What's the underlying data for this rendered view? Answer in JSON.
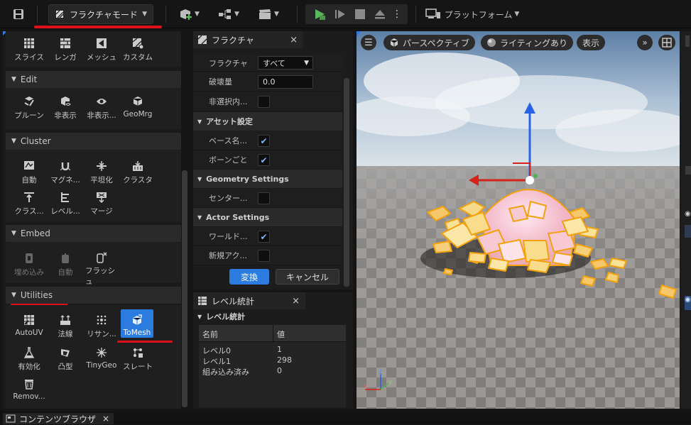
{
  "toolbar": {
    "mode_label": "フラクチャモード",
    "platform_label": "プラットフォーム"
  },
  "colors": {
    "accent": "#2b7be0",
    "annotation": "#e0101a",
    "play": "#5cb85c"
  },
  "tools_top": [
    {
      "label": "スライス",
      "icon": "slice-icon"
    },
    {
      "label": "レンガ",
      "icon": "brick-icon"
    },
    {
      "label": "メッシュ",
      "icon": "mesh-icon"
    },
    {
      "label": "カスタム",
      "icon": "custom-icon"
    }
  ],
  "sections": {
    "edit": {
      "title": "Edit",
      "tools": [
        {
          "label": "プルーン",
          "icon": "prune-icon"
        },
        {
          "label": "非表示",
          "icon": "hide-icon"
        },
        {
          "label": "非表示...",
          "icon": "unhide-icon"
        },
        {
          "label": "GeoMrg",
          "icon": "geomerge-icon"
        }
      ]
    },
    "cluster": {
      "title": "Cluster",
      "tools": [
        {
          "label": "自動",
          "icon": "auto-cluster-icon"
        },
        {
          "label": "マグネ...",
          "icon": "magnet-icon"
        },
        {
          "label": "平坦化",
          "icon": "flatten-icon"
        },
        {
          "label": "クラスタ",
          "icon": "cluster-icon"
        },
        {
          "label": "クラス...",
          "icon": "cluster-up-icon"
        },
        {
          "label": "レベル...",
          "icon": "level-icon"
        },
        {
          "label": "マージ",
          "icon": "merge-icon"
        }
      ]
    },
    "embed": {
      "title": "Embed",
      "tools": [
        {
          "label": "埋め込み",
          "icon": "embed-icon"
        },
        {
          "label": "自動",
          "icon": "auto-embed-icon"
        },
        {
          "label": "フラッシュ",
          "icon": "flush-icon"
        }
      ]
    },
    "utilities": {
      "title": "Utilities",
      "tools": [
        {
          "label": "AutoUV",
          "icon": "autouv-icon"
        },
        {
          "label": "法線",
          "icon": "normals-icon"
        },
        {
          "label": "リサン...",
          "icon": "resample-icon"
        },
        {
          "label": "ToMesh",
          "icon": "tomesh-icon"
        },
        {
          "label": "有効化",
          "icon": "validate-icon"
        },
        {
          "label": "凸型",
          "icon": "convex-icon"
        },
        {
          "label": "TinyGeo",
          "icon": "tinygeo-icon"
        },
        {
          "label": "スレート",
          "icon": "slate-icon"
        },
        {
          "label": "Remov...",
          "icon": "remove-icon"
        }
      ]
    }
  },
  "fracture_panel": {
    "tab_title": "フラクチャ",
    "rows_top": [
      {
        "label": "フラクチャ",
        "value": "すべて"
      },
      {
        "label": "破壊量",
        "value": "0.0"
      },
      {
        "label": "非選択内..."
      }
    ],
    "asset_settings": {
      "title": "アセット設定",
      "rows": [
        "ベース名...",
        "ボーンごと"
      ]
    },
    "geometry_settings": {
      "title": "Geometry Settings",
      "rows": [
        "センター..."
      ]
    },
    "actor_settings": {
      "title": "Actor Settings",
      "rows": [
        "ワールド...",
        "新規アク..."
      ]
    },
    "convert_button": "変換",
    "cancel_button": "キャンセル"
  },
  "level_panel": {
    "tab_title": "レベル統計",
    "section_title": "レベル統計",
    "columns": [
      "名前",
      "値"
    ],
    "rows": [
      [
        "レベル0",
        "1"
      ],
      [
        "レベル1",
        "298"
      ],
      [
        "組み込み済み",
        "0"
      ]
    ]
  },
  "viewport": {
    "perspective_label": "パースペクティブ",
    "lighting_label": "ライティングあり",
    "show_label": "表示"
  },
  "bottom": {
    "content_browser_tab": "コンテンツブラウザ"
  }
}
